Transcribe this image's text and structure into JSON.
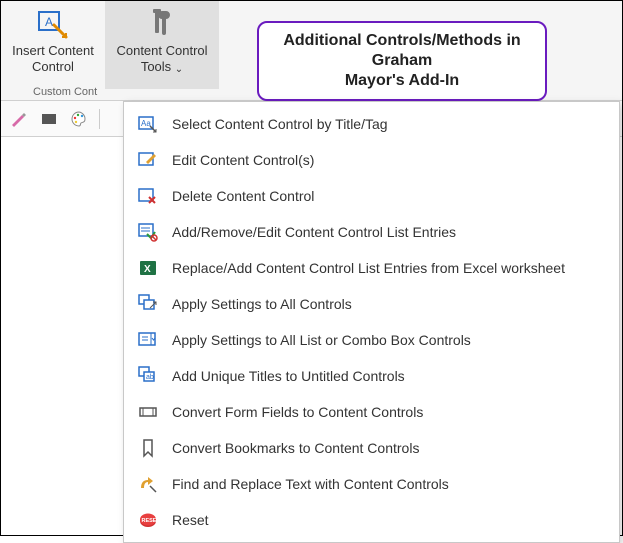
{
  "ribbon": {
    "insert_label_l1": "Insert Content",
    "insert_label_l2": "Control",
    "tools_label_l1": "Content Control",
    "tools_label_l2": "Tools",
    "group_label": "Custom Cont"
  },
  "callout": {
    "line1": "Additional Controls/Methods in Graham",
    "line2": "Mayor's Add-In"
  },
  "menu": {
    "items": [
      "Select Content Control by Title/Tag",
      "Edit Content Control(s)",
      "Delete Content Control",
      "Add/Remove/Edit Content Control List Entries",
      "Replace/Add Content Control List Entries from Excel worksheet",
      "Apply Settings to All Controls",
      "Apply Settings to All List or Combo Box Controls",
      "Add Unique Titles to Untitled Controls",
      "Convert Form Fields to Content Controls",
      "Convert Bookmarks to Content Controls",
      "Find and Replace Text with Content Controls",
      "Reset"
    ]
  }
}
